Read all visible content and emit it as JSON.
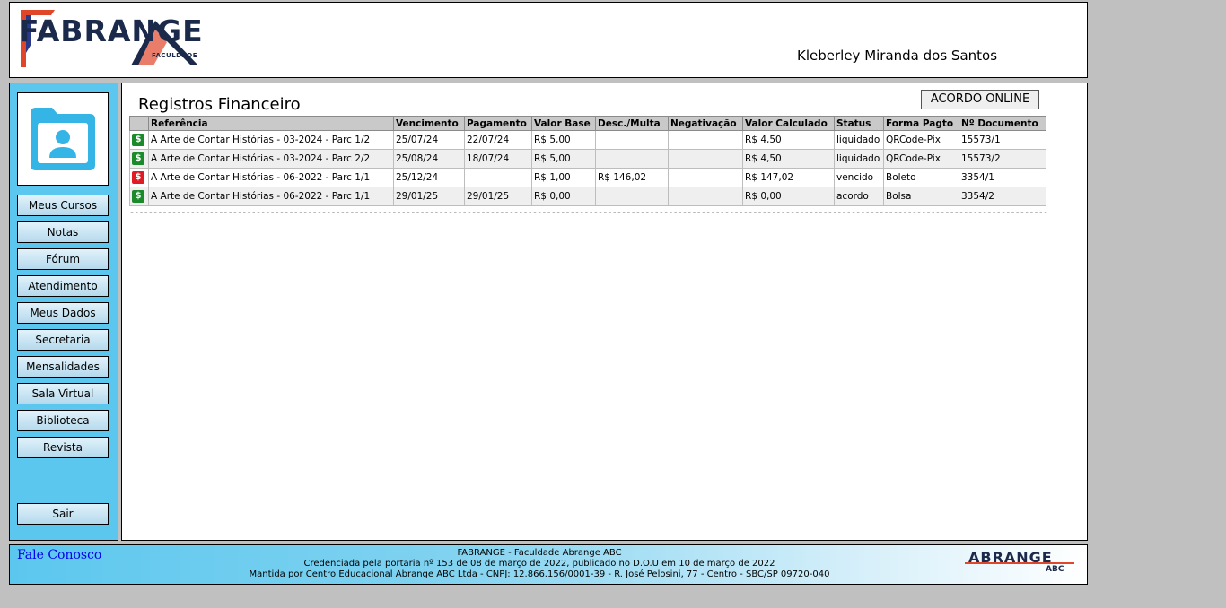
{
  "header": {
    "logo_text": "FABRANGE",
    "logo_subtitle": "FACULDADE",
    "user_name": "Kleberley Miranda dos Santos"
  },
  "sidebar": {
    "avatar_icon": "user-folder-icon",
    "items": [
      {
        "label": "Meus Cursos"
      },
      {
        "label": "Notas"
      },
      {
        "label": "Fórum"
      },
      {
        "label": "Atendimento"
      },
      {
        "label": "Meus Dados"
      },
      {
        "label": "Secretaria"
      },
      {
        "label": "Mensalidades"
      },
      {
        "label": "Sala Virtual"
      },
      {
        "label": "Biblioteca"
      },
      {
        "label": "Revista"
      }
    ],
    "logout_label": "Sair"
  },
  "main": {
    "title": "Registros Financeiro",
    "acordo_button": "ACORDO ONLINE",
    "columns": [
      "Referência",
      "Vencimento",
      "Pagamento",
      "Valor Base",
      "Desc./Multa",
      "Negativação",
      "Valor Calculado",
      "Status",
      "Forma Pagto",
      "Nº Documento"
    ],
    "rows": [
      {
        "icon_color": "#1a8a2a",
        "icon": "$",
        "referencia": "A Arte de Contar Histórias - 03-2024 - Parc 1/2",
        "vencimento": "25/07/24",
        "pagamento": "22/07/24",
        "valor_base": "R$ 5,00",
        "desc_multa": "",
        "negativacao": "",
        "valor_calculado": "R$ 4,50",
        "status": "liquidado",
        "forma_pagto": "QRCode-Pix",
        "documento": "15573/1"
      },
      {
        "icon_color": "#1a8a2a",
        "icon": "$",
        "referencia": "A Arte de Contar Histórias - 03-2024 - Parc 2/2",
        "vencimento": "25/08/24",
        "pagamento": "18/07/24",
        "valor_base": "R$ 5,00",
        "desc_multa": "",
        "negativacao": "",
        "valor_calculado": "R$ 4,50",
        "status": "liquidado",
        "forma_pagto": "QRCode-Pix",
        "documento": "15573/2"
      },
      {
        "icon_color": "#e01b24",
        "icon": "$",
        "referencia": "A Arte de Contar Histórias - 06-2022 - Parc 1/1",
        "vencimento": "25/12/24",
        "pagamento": "",
        "valor_base": "R$ 1,00",
        "desc_multa": "R$ 146,02",
        "negativacao": "",
        "valor_calculado": "R$ 147,02",
        "status": "vencido",
        "forma_pagto": "Boleto",
        "documento": "3354/1"
      },
      {
        "icon_color": "#1a8a2a",
        "icon": "$",
        "referencia": "A Arte de Contar Histórias - 06-2022 - Parc 1/1",
        "vencimento": "29/01/25",
        "pagamento": "29/01/25",
        "valor_base": "R$ 0,00",
        "desc_multa": "",
        "negativacao": "",
        "valor_calculado": "R$ 0,00",
        "status": "acordo",
        "forma_pagto": "Bolsa",
        "documento": "3354/2"
      }
    ],
    "divider": "----------------------------------------------------------------------------------------------------------------------------------------------------------------------------------------------------"
  },
  "footer": {
    "link": "Fale Conosco",
    "line1": "FABRANGE - Faculdade Abrange ABC",
    "line2": "Credenciada pela portaria nº 153 de 08 de março de 2022, publicado no D.O.U em 10 de março de 2022",
    "line3": "Mantida por Centro Educacional Abrange ABC Ltda - CNPJ: 12.866.156/0001-39 - R. José Pelosini, 77 - Centro - SBC/SP 09720-040",
    "logo_text": "ABRANGE",
    "logo_sub": "ABC"
  }
}
